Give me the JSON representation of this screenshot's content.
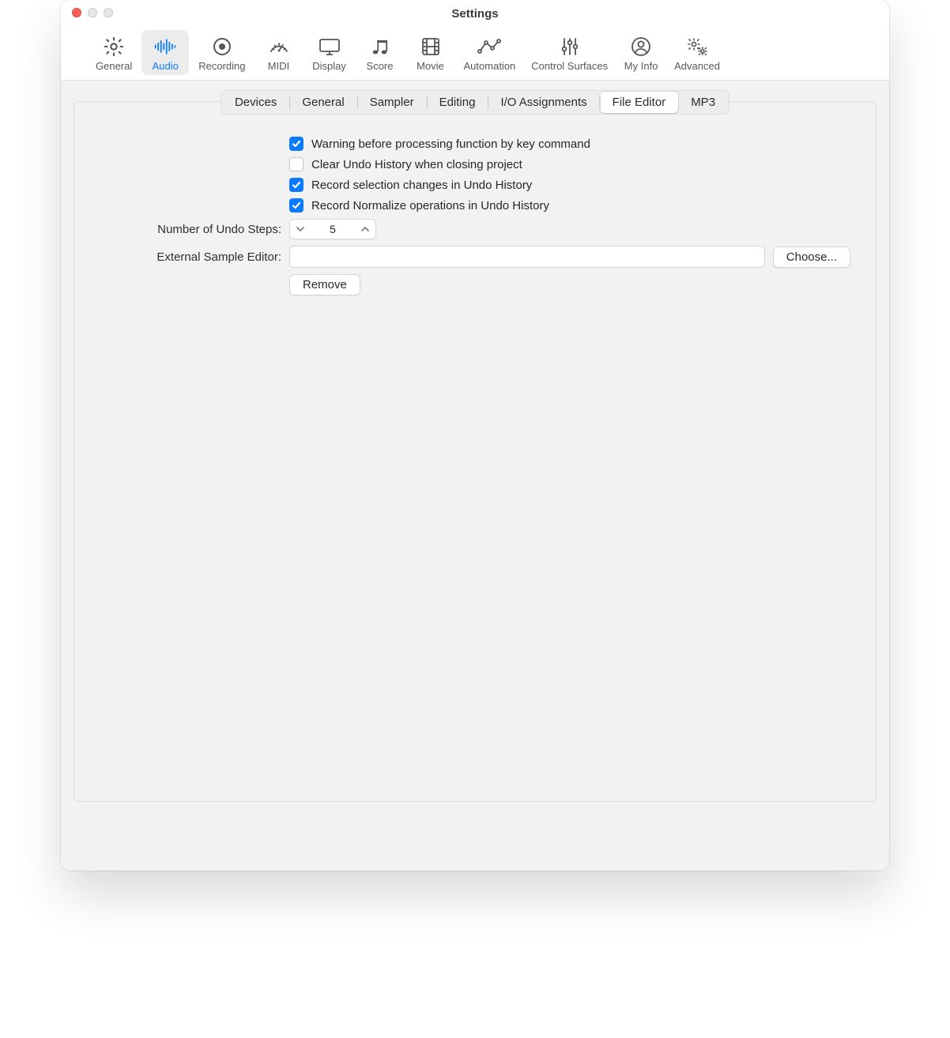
{
  "window": {
    "title": "Settings"
  },
  "toolbar": [
    {
      "id": "general",
      "label": "General",
      "icon": "gear",
      "selected": false
    },
    {
      "id": "audio",
      "label": "Audio",
      "icon": "waveform",
      "selected": true
    },
    {
      "id": "recording",
      "label": "Recording",
      "icon": "record",
      "selected": false
    },
    {
      "id": "midi",
      "label": "MIDI",
      "icon": "gauge",
      "selected": false
    },
    {
      "id": "display",
      "label": "Display",
      "icon": "display",
      "selected": false
    },
    {
      "id": "score",
      "label": "Score",
      "icon": "notes",
      "selected": false
    },
    {
      "id": "movie",
      "label": "Movie",
      "icon": "film",
      "selected": false
    },
    {
      "id": "automation",
      "label": "Automation",
      "icon": "automation",
      "selected": false
    },
    {
      "id": "control-surfaces",
      "label": "Control Surfaces",
      "icon": "sliders",
      "selected": false
    },
    {
      "id": "my-info",
      "label": "My Info",
      "icon": "person",
      "selected": false
    },
    {
      "id": "advanced",
      "label": "Advanced",
      "icon": "gears",
      "selected": false
    }
  ],
  "tabs": [
    {
      "id": "devices",
      "label": "Devices",
      "active": false
    },
    {
      "id": "general",
      "label": "General",
      "active": false
    },
    {
      "id": "sampler",
      "label": "Sampler",
      "active": false
    },
    {
      "id": "editing",
      "label": "Editing",
      "active": false
    },
    {
      "id": "io-assignments",
      "label": "I/O Assignments",
      "active": false
    },
    {
      "id": "file-editor",
      "label": "File Editor",
      "active": true
    },
    {
      "id": "mp3",
      "label": "MP3",
      "active": false
    }
  ],
  "options": {
    "warn_before_processing": {
      "label": "Warning before processing function by key command",
      "checked": true
    },
    "clear_undo_on_close": {
      "label": "Clear Undo History when closing project",
      "checked": false
    },
    "record_selection_undo": {
      "label": "Record selection changes in Undo History",
      "checked": true
    },
    "record_normalize_undo": {
      "label": "Record Normalize operations in Undo History",
      "checked": true
    }
  },
  "undo_steps": {
    "label": "Number of Undo Steps:",
    "value": "5"
  },
  "external_editor": {
    "label": "External Sample Editor:",
    "value": "",
    "choose_label": "Choose...",
    "remove_label": "Remove"
  }
}
